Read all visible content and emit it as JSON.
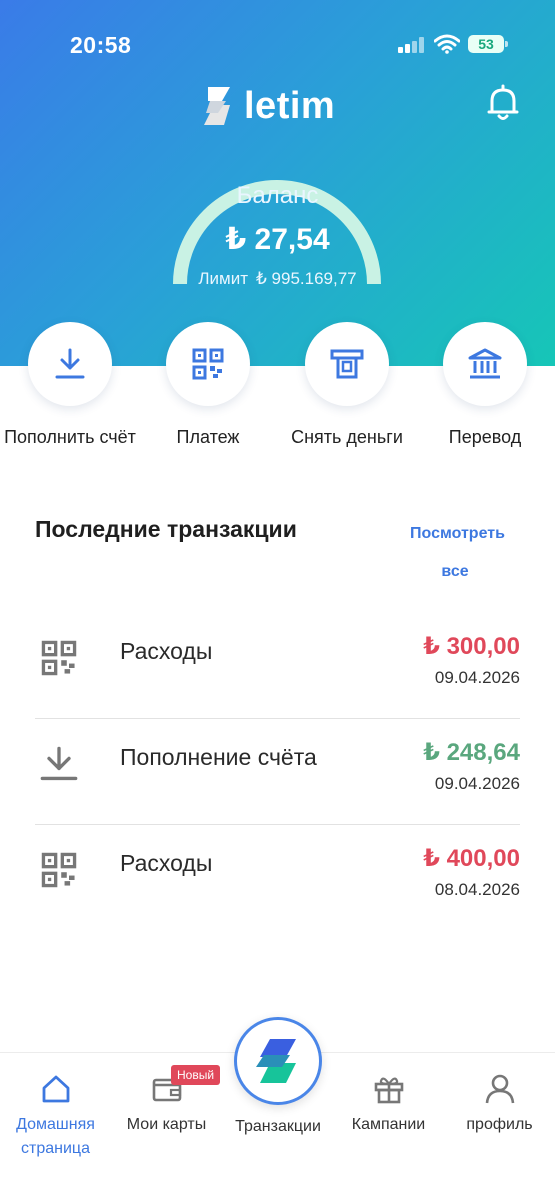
{
  "status": {
    "time": "20:58",
    "battery": "53"
  },
  "header": {
    "logo_text": "letim",
    "logo_icon": "lightning-logo-icon",
    "notification_icon": "bell-icon"
  },
  "balance": {
    "label": "Баланс",
    "value": "₺ 27,54",
    "limit_label": "Лимит",
    "limit_value": "₺ 995.169,77"
  },
  "actions": [
    {
      "label": "Пополнить счёт",
      "icon": "download-icon"
    },
    {
      "label": "Платеж",
      "icon": "qr-code-icon"
    },
    {
      "label": "Снять деньги",
      "icon": "atm-icon"
    },
    {
      "label": "Перевод",
      "icon": "bank-icon"
    }
  ],
  "transactions_section": {
    "title": "Последние транзакции",
    "see_all": "Посмотреть все"
  },
  "transactions": [
    {
      "name": "Расходы",
      "amount": "₺ 300,00",
      "date": "09.04.2026",
      "kind": "expense",
      "icon": "qr-code-icon"
    },
    {
      "name": "Пополнение счёта",
      "amount": "₺ 248,64",
      "date": "09.04.2026",
      "kind": "income",
      "icon": "download-icon"
    },
    {
      "name": "Расходы",
      "amount": "₺ 400,00",
      "date": "08.04.2026",
      "kind": "expense",
      "icon": "qr-code-icon"
    }
  ],
  "tabbar": {
    "home": "Домашняя страница",
    "cards": "Мои карты",
    "cards_badge": "Новый",
    "transactions": "Транзакции",
    "campaigns": "Кампании",
    "profile": "профиль"
  },
  "colors": {
    "accent": "#3d78e0",
    "expense": "#e0485a",
    "income": "#5aa77e",
    "gauge": "#c9f2e4"
  }
}
